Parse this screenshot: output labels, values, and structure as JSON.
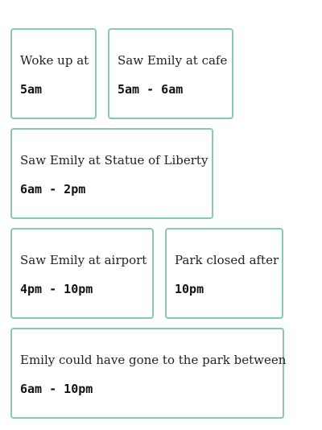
{
  "cards": [
    {
      "label": "Woke up at",
      "value": "5am"
    },
    {
      "label": "Saw Emily at cafe",
      "value": "5am - 6am"
    },
    {
      "label": "Saw Emily at Statue of Liberty",
      "value": "6am - 2pm"
    },
    {
      "label": "Saw Emily at airport",
      "value": "4pm - 10pm"
    },
    {
      "label": "Park closed after",
      "value": "10pm"
    },
    {
      "label": "Emily could have gone to the park between",
      "value": "6am - 10pm"
    }
  ],
  "colors": {
    "card_border": "#8cc7b3",
    "text": "#222222"
  }
}
